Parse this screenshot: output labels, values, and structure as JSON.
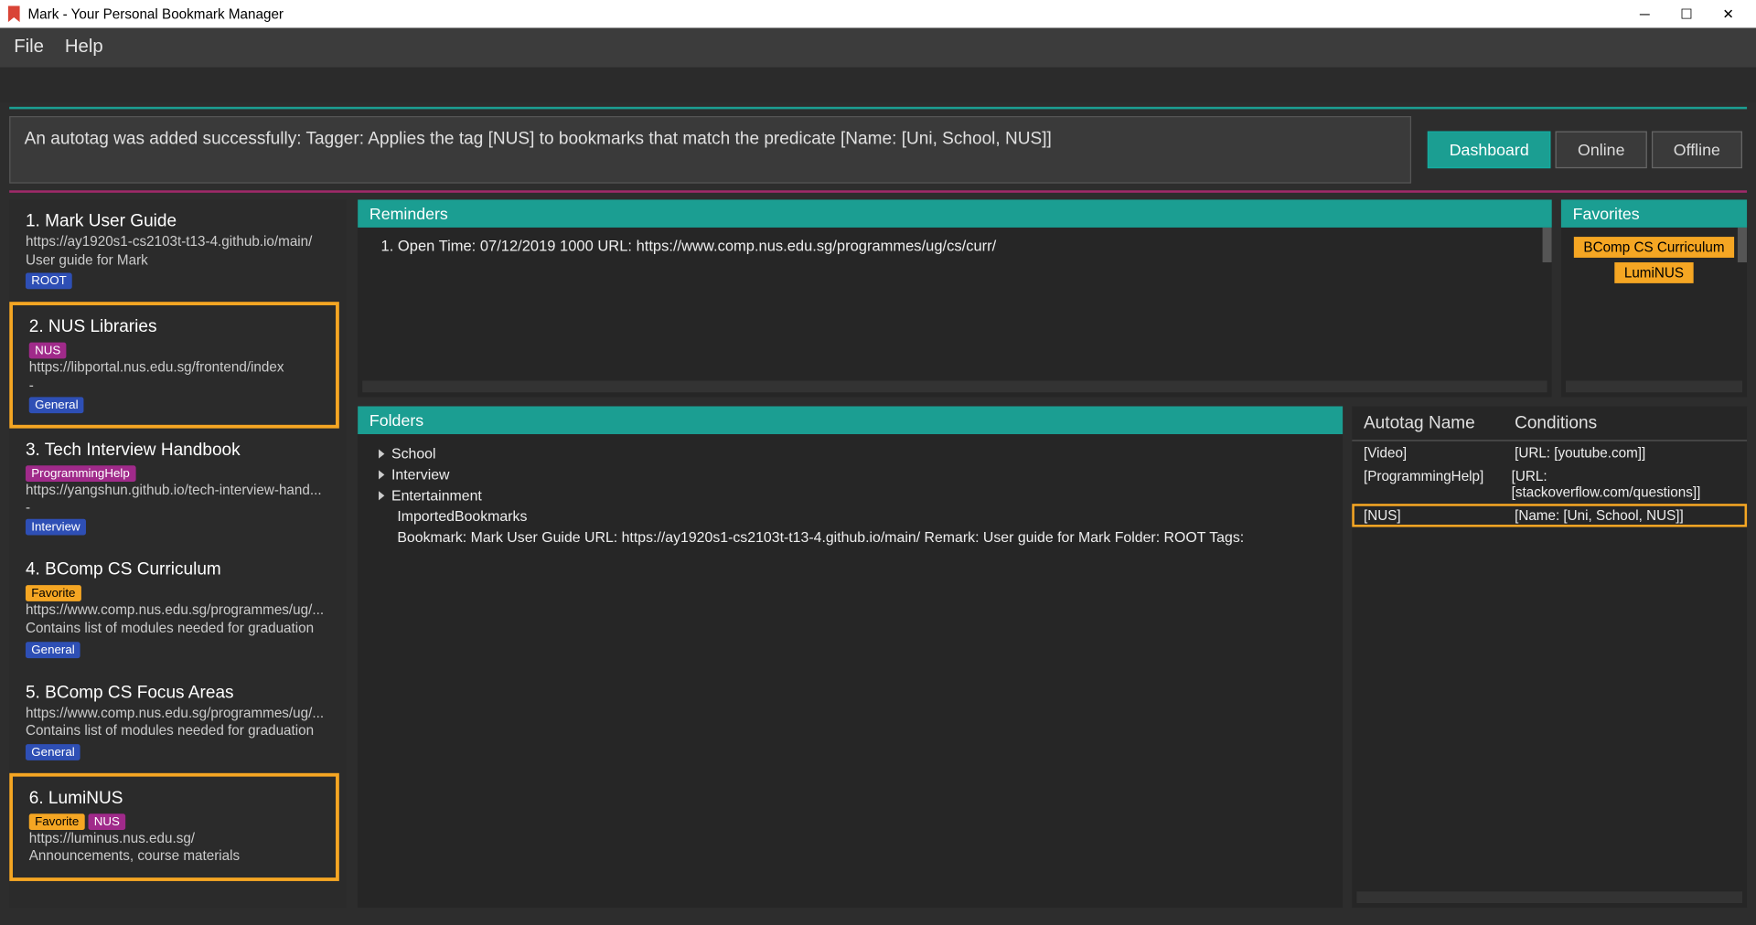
{
  "window": {
    "title": "Mark - Your Personal Bookmark Manager"
  },
  "menu": {
    "file": "File",
    "help": "Help"
  },
  "status": {
    "message": "An autotag was added successfully: Tagger: Applies the tag [NUS] to bookmarks that match the predicate [Name: [Uni, School, NUS]]"
  },
  "tabs": {
    "dashboard": "Dashboard",
    "online": "Online",
    "offline": "Offline"
  },
  "bookmarks": [
    {
      "title": "1.   Mark User Guide",
      "url": "https://ay1920s1-cs2103t-t13-4.github.io/main/",
      "desc": "User guide for Mark",
      "tags": [
        {
          "cls": "root",
          "txt": "ROOT"
        }
      ],
      "highlighted": false
    },
    {
      "title": "2.   NUS Libraries",
      "pretags": [
        {
          "cls": "nus",
          "txt": "NUS"
        }
      ],
      "url": "https://libportal.nus.edu.sg/frontend/index",
      "dash": "-",
      "tags": [
        {
          "cls": "general",
          "txt": "General"
        }
      ],
      "highlighted": true
    },
    {
      "title": "3.   Tech Interview Handbook",
      "pretags": [
        {
          "cls": "programminghelp",
          "txt": "ProgrammingHelp"
        }
      ],
      "url": "https://yangshun.github.io/tech-interview-hand...",
      "dash": "-",
      "tags": [
        {
          "cls": "interview",
          "txt": "Interview"
        }
      ],
      "highlighted": false
    },
    {
      "title": "4.   BComp CS Curriculum",
      "pretags": [
        {
          "cls": "favorite",
          "txt": "Favorite"
        }
      ],
      "url": "https://www.comp.nus.edu.sg/programmes/ug/...",
      "desc": "Contains list of modules needed for graduation",
      "tags": [
        {
          "cls": "general",
          "txt": "General"
        }
      ],
      "highlighted": false
    },
    {
      "title": "5.   BComp CS Focus Areas",
      "url": "https://www.comp.nus.edu.sg/programmes/ug/...",
      "desc": "Contains list of modules needed for graduation",
      "tags": [
        {
          "cls": "general",
          "txt": "General"
        }
      ],
      "highlighted": false
    },
    {
      "title": "6.   LumiNUS",
      "pretags": [
        {
          "cls": "favorite",
          "txt": "Favorite"
        },
        {
          "cls": "nus",
          "txt": "NUS"
        }
      ],
      "url": "https://luminus.nus.edu.sg/",
      "desc": "Announcements, course materials",
      "highlighted": true
    }
  ],
  "reminders": {
    "header": "Reminders",
    "item": "1. Open Time: 07/12/2019 1000 URL: https://www.comp.nus.edu.sg/programmes/ug/cs/curr/"
  },
  "favorites": {
    "header": "Favorites",
    "items": [
      "BComp CS Curriculum",
      "LumiNUS"
    ]
  },
  "folders": {
    "header": "Folders",
    "tree": [
      "School",
      "Interview",
      "Entertainment"
    ],
    "plain": "ImportedBookmarks",
    "detail": "Bookmark: Mark User Guide URL: https://ay1920s1-cs2103t-t13-4.github.io/main/ Remark: User guide for Mark Folder: ROOT Tags:"
  },
  "autotag": {
    "header_name": "Autotag Name",
    "header_cond": "Conditions",
    "rows": [
      {
        "name": "[Video]",
        "cond": "[URL: [youtube.com]]",
        "hl": false
      },
      {
        "name": "[ProgrammingHelp]",
        "cond": "[URL: [stackoverflow.com/questions]]",
        "hl": false
      },
      {
        "name": "[NUS]",
        "cond": "[Name: [Uni, School, NUS]]",
        "hl": true
      }
    ]
  }
}
